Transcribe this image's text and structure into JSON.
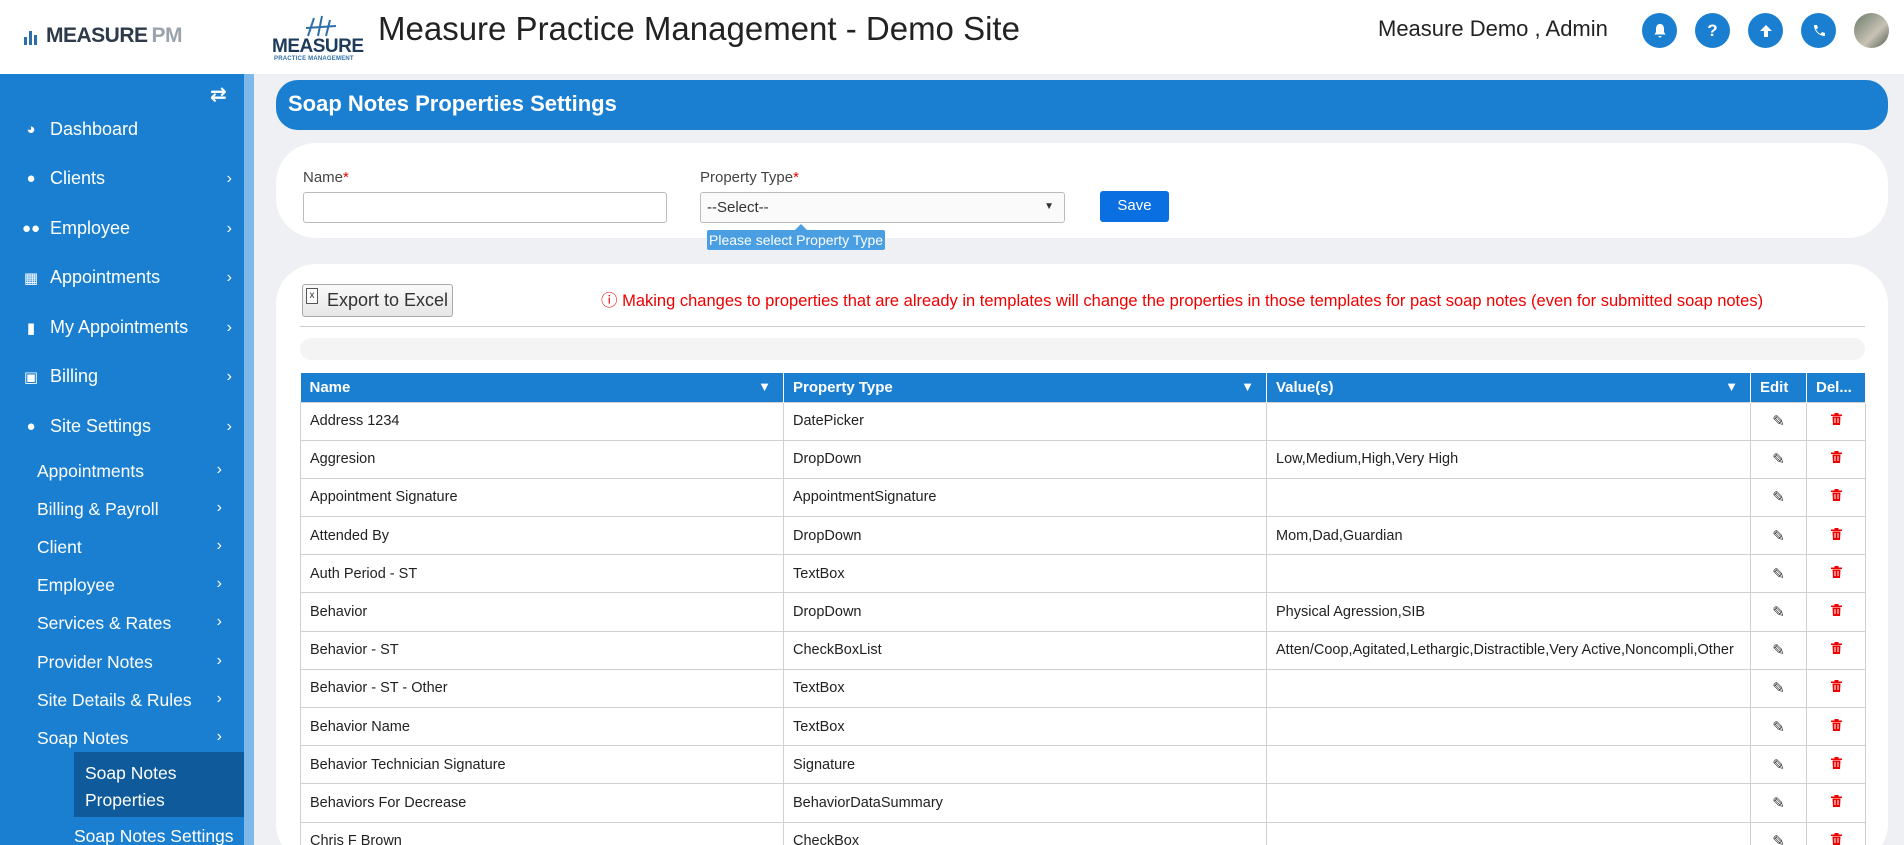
{
  "header": {
    "brand_main": "MEASURE",
    "brand_pm": "PM",
    "site_logo_word": "MEASURE",
    "site_logo_sub": "PRACTICE MANAGEMENT",
    "title": "Measure Practice Management - Demo Site",
    "user": "Measure Demo , Admin",
    "icons": [
      "bell-icon",
      "help-icon",
      "upload-icon",
      "phone-icon",
      "avatar"
    ]
  },
  "sidebar": {
    "items": [
      {
        "label": "Dashboard",
        "icon": "dashboard-icon"
      },
      {
        "label": "Clients",
        "icon": "user-icon"
      },
      {
        "label": "Employee",
        "icon": "users-icon"
      },
      {
        "label": "Appointments",
        "icon": "calendar-icon"
      },
      {
        "label": "My Appointments",
        "icon": "book-icon"
      },
      {
        "label": "Billing",
        "icon": "money-icon"
      },
      {
        "label": "Site Settings",
        "icon": "user-icon"
      }
    ],
    "sub_items": [
      "Appointments",
      "Billing & Payroll",
      "Client",
      "Employee",
      "Services & Rates",
      "Provider Notes",
      "Site Details & Rules",
      "Soap Notes"
    ],
    "active_leaf": "Soap Notes Properties",
    "next_leaf": "Soap Notes Settings"
  },
  "page": {
    "title": "Soap Notes Properties Settings",
    "name_label": "Name",
    "required_mark": "*",
    "property_type_label": "Property Type",
    "select_value": "--Select--",
    "save_label": "Save",
    "tooltip": "Please select Property Type",
    "export_label": "Export to Excel",
    "warning": "Making changes to properties that are already in templates will change the properties in those templates for past soap notes (even for submitted soap notes)"
  },
  "table": {
    "columns": [
      "Name",
      "Property Type",
      "Value(s)",
      "Edit",
      "Del..."
    ],
    "rows": [
      [
        "Address 1234",
        "DatePicker",
        ""
      ],
      [
        "Aggresion",
        "DropDown",
        "Low,Medium,High,Very High"
      ],
      [
        "Appointment Signature",
        "AppointmentSignature",
        ""
      ],
      [
        "Attended By",
        "DropDown",
        "Mom,Dad,Guardian"
      ],
      [
        "Auth Period - ST",
        "TextBox",
        ""
      ],
      [
        "Behavior",
        "DropDown",
        "Physical Agression,SIB"
      ],
      [
        "Behavior - ST",
        "CheckBoxList",
        "Atten/Coop,Agitated,Lethargic,Distractible,Very Active,Noncompli,Other"
      ],
      [
        "Behavior - ST - Other",
        "TextBox",
        ""
      ],
      [
        "Behavior Name",
        "TextBox",
        ""
      ],
      [
        "Behavior Technician Signature",
        "Signature",
        ""
      ],
      [
        "Behaviors For Decrease",
        "BehaviorDataSummary",
        ""
      ],
      [
        "Chris F Brown",
        "CheckBox",
        ""
      ]
    ]
  },
  "colors": {
    "primary": "#1a7fd1",
    "danger": "#ee0000",
    "save": "#0a6fe0"
  }
}
